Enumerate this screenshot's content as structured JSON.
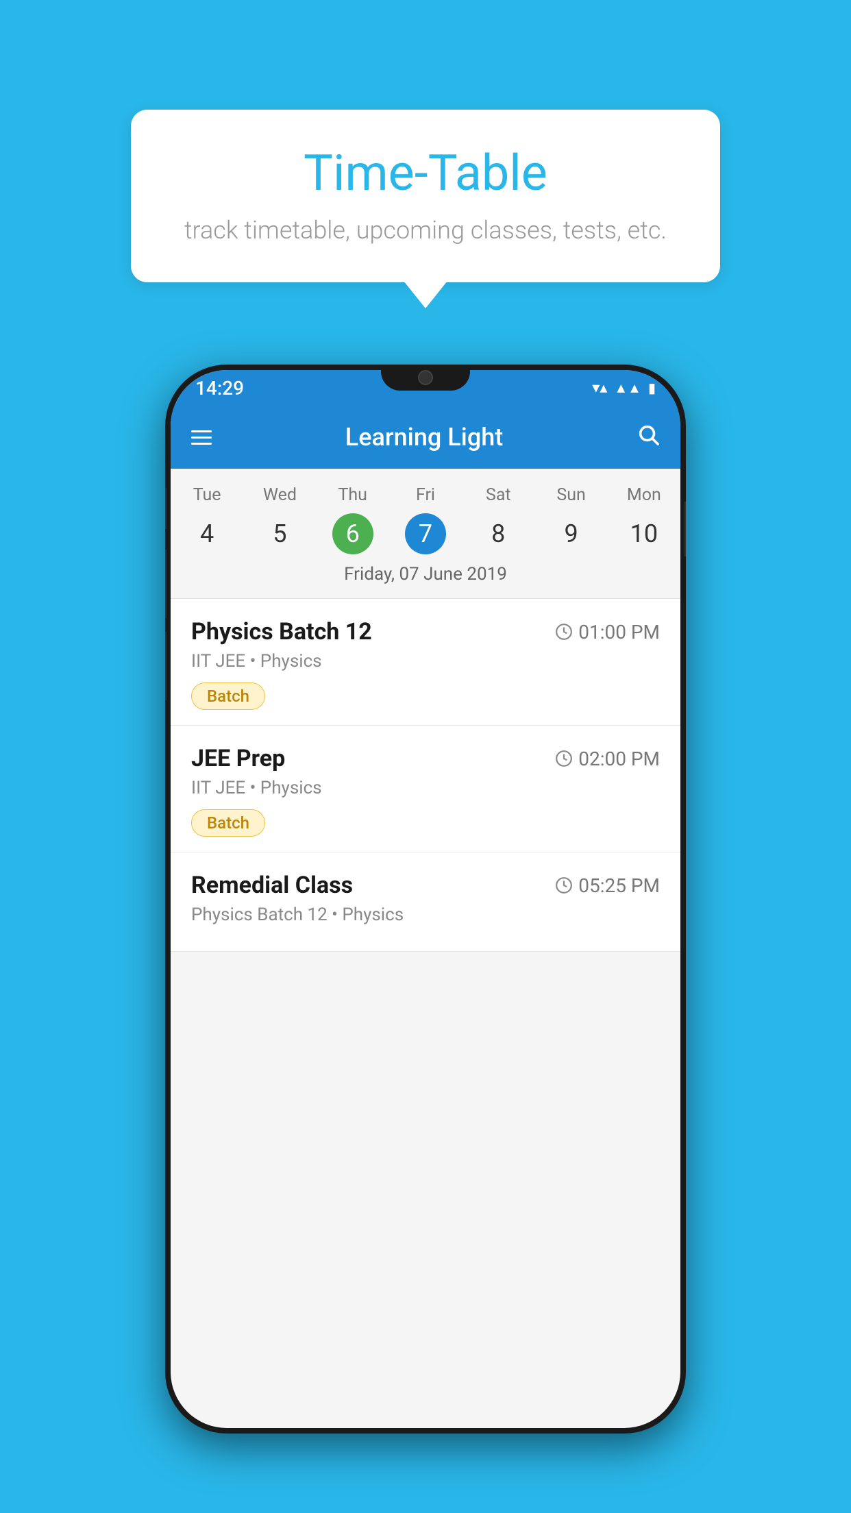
{
  "background_color": "#29B6E8",
  "tooltip": {
    "title": "Time-Table",
    "subtitle": "track timetable, upcoming classes, tests, etc."
  },
  "phone": {
    "status_bar": {
      "time": "14:29"
    },
    "app_bar": {
      "title": "Learning Light"
    },
    "calendar": {
      "days": [
        "Tue",
        "Wed",
        "Thu",
        "Fri",
        "Sat",
        "Sun",
        "Mon"
      ],
      "dates": [
        "4",
        "5",
        "6",
        "7",
        "8",
        "9",
        "10"
      ],
      "today_index": 2,
      "selected_index": 3,
      "selected_date_label": "Friday, 07 June 2019"
    },
    "schedule": [
      {
        "title": "Physics Batch 12",
        "time": "01:00 PM",
        "subject": "IIT JEE • Physics",
        "badge": "Batch"
      },
      {
        "title": "JEE Prep",
        "time": "02:00 PM",
        "subject": "IIT JEE • Physics",
        "badge": "Batch"
      },
      {
        "title": "Remedial Class",
        "time": "05:25 PM",
        "subject": "Physics Batch 12 • Physics",
        "badge": null
      }
    ]
  }
}
